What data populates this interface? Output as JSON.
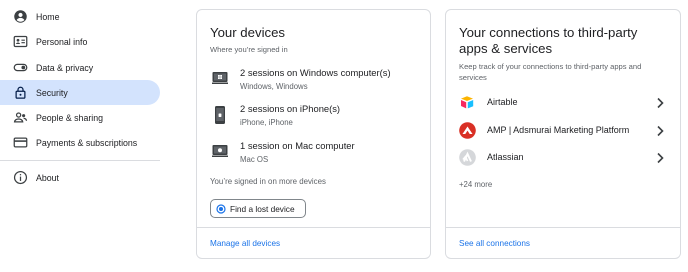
{
  "sidebar": {
    "items": [
      {
        "label": "Home",
        "icon": "account-circle-icon"
      },
      {
        "label": "Personal info",
        "icon": "id-card-icon"
      },
      {
        "label": "Data & privacy",
        "icon": "toggle-icon"
      },
      {
        "label": "Security",
        "icon": "lock-icon",
        "active": true
      },
      {
        "label": "People & sharing",
        "icon": "people-icon"
      },
      {
        "label": "Payments & subscriptions",
        "icon": "credit-card-icon"
      },
      {
        "label": "About",
        "icon": "info-icon"
      }
    ]
  },
  "devices": {
    "title": "Your devices",
    "subtitle": "Where you’re signed in",
    "rows": [
      {
        "title": "2 sessions on Windows computer(s)",
        "detail": "Windows, Windows",
        "icon": "windows-computer-icon"
      },
      {
        "title": "2 sessions on iPhone(s)",
        "detail": "iPhone, iPhone",
        "icon": "phone-icon"
      },
      {
        "title": "1 session on Mac computer",
        "detail": "Mac OS",
        "icon": "mac-computer-icon"
      }
    ],
    "more_text": "You’re signed in on more devices",
    "find_button": "Find a lost device",
    "footer_link": "Manage all devices"
  },
  "connections": {
    "title_line1": "Your connections to third-party",
    "title_line2": "apps & services",
    "subtitle_line1": "Keep track of your connections to third-party apps and",
    "subtitle_line2": "services",
    "apps": [
      {
        "name": "Airtable",
        "icon": "airtable-logo"
      },
      {
        "name": "AMP | Adsmurai Marketing Platform",
        "icon": "adsmurai-logo"
      },
      {
        "name": "Atlassian",
        "icon": "atlassian-logo"
      }
    ],
    "more": "+24 more",
    "footer_link": "See all connections"
  },
  "colors": {
    "active_nav": "#d3e3fd",
    "link": "#1a73e8",
    "border": "#dadce0"
  }
}
